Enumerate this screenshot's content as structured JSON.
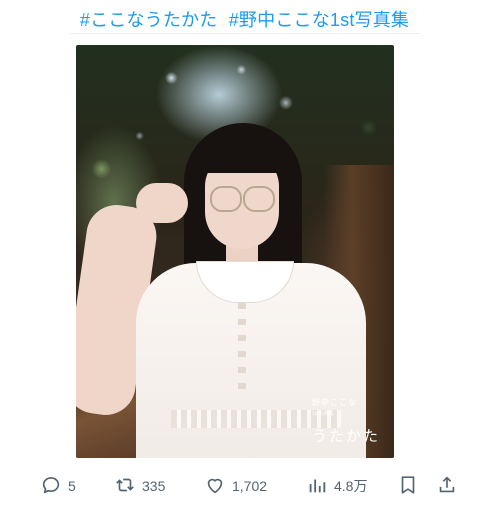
{
  "post": {
    "hashtags": [
      "#ここなうたかた",
      "#野中ここな1st写真集"
    ],
    "photo": {
      "caption_name": "野中ここな",
      "caption_sub": "1st写真集",
      "caption_title": "うたかた"
    }
  },
  "actions": {
    "replies": "5",
    "reposts": "335",
    "likes": "1,702",
    "views": "4.8万"
  },
  "colors": {
    "hashtag": "#1d9bf0",
    "icon": "#536471"
  },
  "icons": [
    "reply-icon",
    "repost-icon",
    "like-icon",
    "views-icon",
    "bookmark-icon",
    "share-icon"
  ]
}
